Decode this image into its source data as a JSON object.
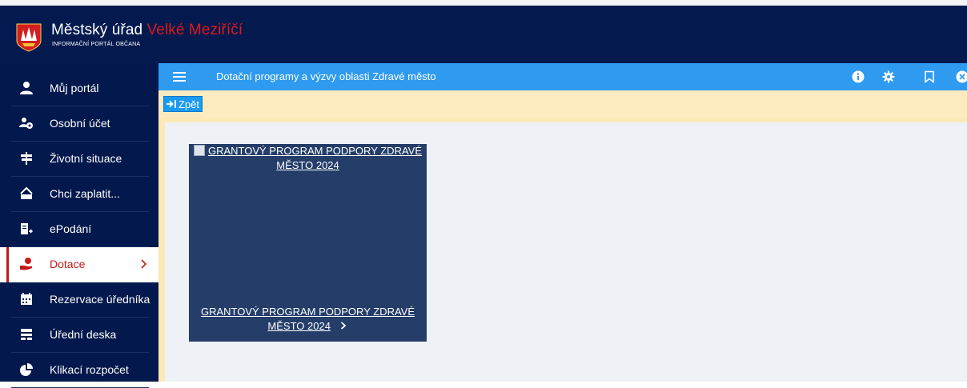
{
  "header": {
    "title_main": "Městský úřad",
    "title_accent": "Velké Meziříčí",
    "subtitle": "INFORMAČNÍ PORTÁL OBČANA"
  },
  "sidebar": {
    "items": [
      {
        "label": "Můj portál",
        "icon": "user-icon"
      },
      {
        "label": "Osobní účet",
        "icon": "user-coins-icon"
      },
      {
        "label": "Životní situace",
        "icon": "signpost-icon"
      },
      {
        "label": "Chci zaplatit...",
        "icon": "payment-icon"
      },
      {
        "label": "ePodání",
        "icon": "document-send-icon"
      },
      {
        "label": "Dotace",
        "icon": "hand-money-icon",
        "active": true
      },
      {
        "label": "Rezervace úředníka",
        "icon": "calendar-icon"
      },
      {
        "label": "Úřední deska",
        "icon": "notice-board-icon"
      },
      {
        "label": "Klikací rozpočet",
        "icon": "pie-chart-icon"
      }
    ]
  },
  "toolbar": {
    "title": "Dotační programy a výzvy oblasti Zdravé město",
    "icons": [
      "info-icon",
      "gear-icon",
      "bookmark-icon",
      "close-icon"
    ]
  },
  "subbar": {
    "back_label": "Zpět"
  },
  "cards": [
    {
      "image_alt": "GRANTOVÝ PROGRAM PODPORY ZDRAVÉ MĚSTO 2024",
      "link_line1": "GRANTOVÝ PROGRAM PODPORY ZDRAVÉ",
      "link_line2": "MĚSTO 2024"
    }
  ],
  "colors": {
    "header_bg": "#041a4f",
    "sidebar_bg": "#03184c",
    "toolbar_bg": "#2e9bf0",
    "subbar_bg": "#fdebc0",
    "accent_red": "#e01818",
    "card_bg": "#243d69"
  }
}
